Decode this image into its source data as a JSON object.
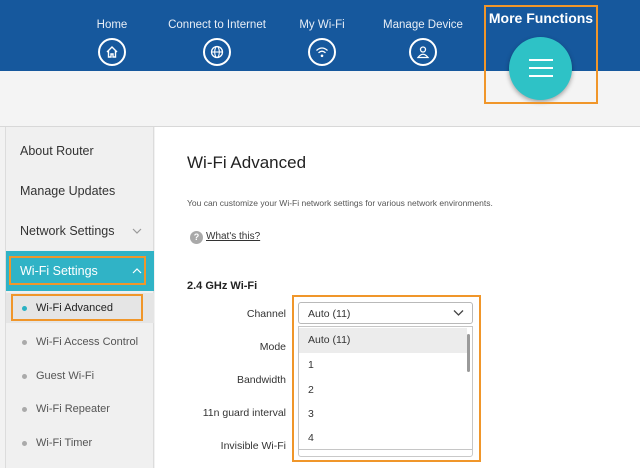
{
  "header": {
    "nav": [
      {
        "label": "Home",
        "icon": "home-icon"
      },
      {
        "label": "Connect to Internet",
        "icon": "globe-icon"
      },
      {
        "label": "My Wi-Fi",
        "icon": "wifi-icon"
      },
      {
        "label": "Manage Device",
        "icon": "user-icon"
      }
    ],
    "more_functions": {
      "label": "More Functions",
      "icon": "menu-icon"
    }
  },
  "sidebar": {
    "items": [
      {
        "label": "About Router"
      },
      {
        "label": "Manage Updates"
      },
      {
        "label": "Network Settings"
      },
      {
        "label": "Wi-Fi Settings"
      }
    ],
    "sub_items": [
      {
        "label": "Wi-Fi Advanced"
      },
      {
        "label": "Wi-Fi Access Control"
      },
      {
        "label": "Guest Wi-Fi"
      },
      {
        "label": "Wi-Fi Repeater"
      },
      {
        "label": "Wi-Fi Timer"
      }
    ]
  },
  "main": {
    "title": "Wi-Fi Advanced",
    "description": "You can customize your Wi-Fi network settings for various network environments.",
    "help_link": "What's this?",
    "help_icon": "?",
    "section_title": "2.4 GHz Wi-Fi",
    "fields": [
      {
        "label": "Channel"
      },
      {
        "label": "Mode"
      },
      {
        "label": "Bandwidth"
      },
      {
        "label": "11n guard interval"
      },
      {
        "label": "Invisible Wi-Fi"
      }
    ],
    "channel_value": "Auto (11)",
    "channel_options": [
      "Auto (11)",
      "1",
      "2",
      "3",
      "4"
    ]
  },
  "colors": {
    "header_bg": "#16589d",
    "accent": "#2ec2c6",
    "active_item": "#30b3c6",
    "highlight_frame": "#f0962a"
  }
}
